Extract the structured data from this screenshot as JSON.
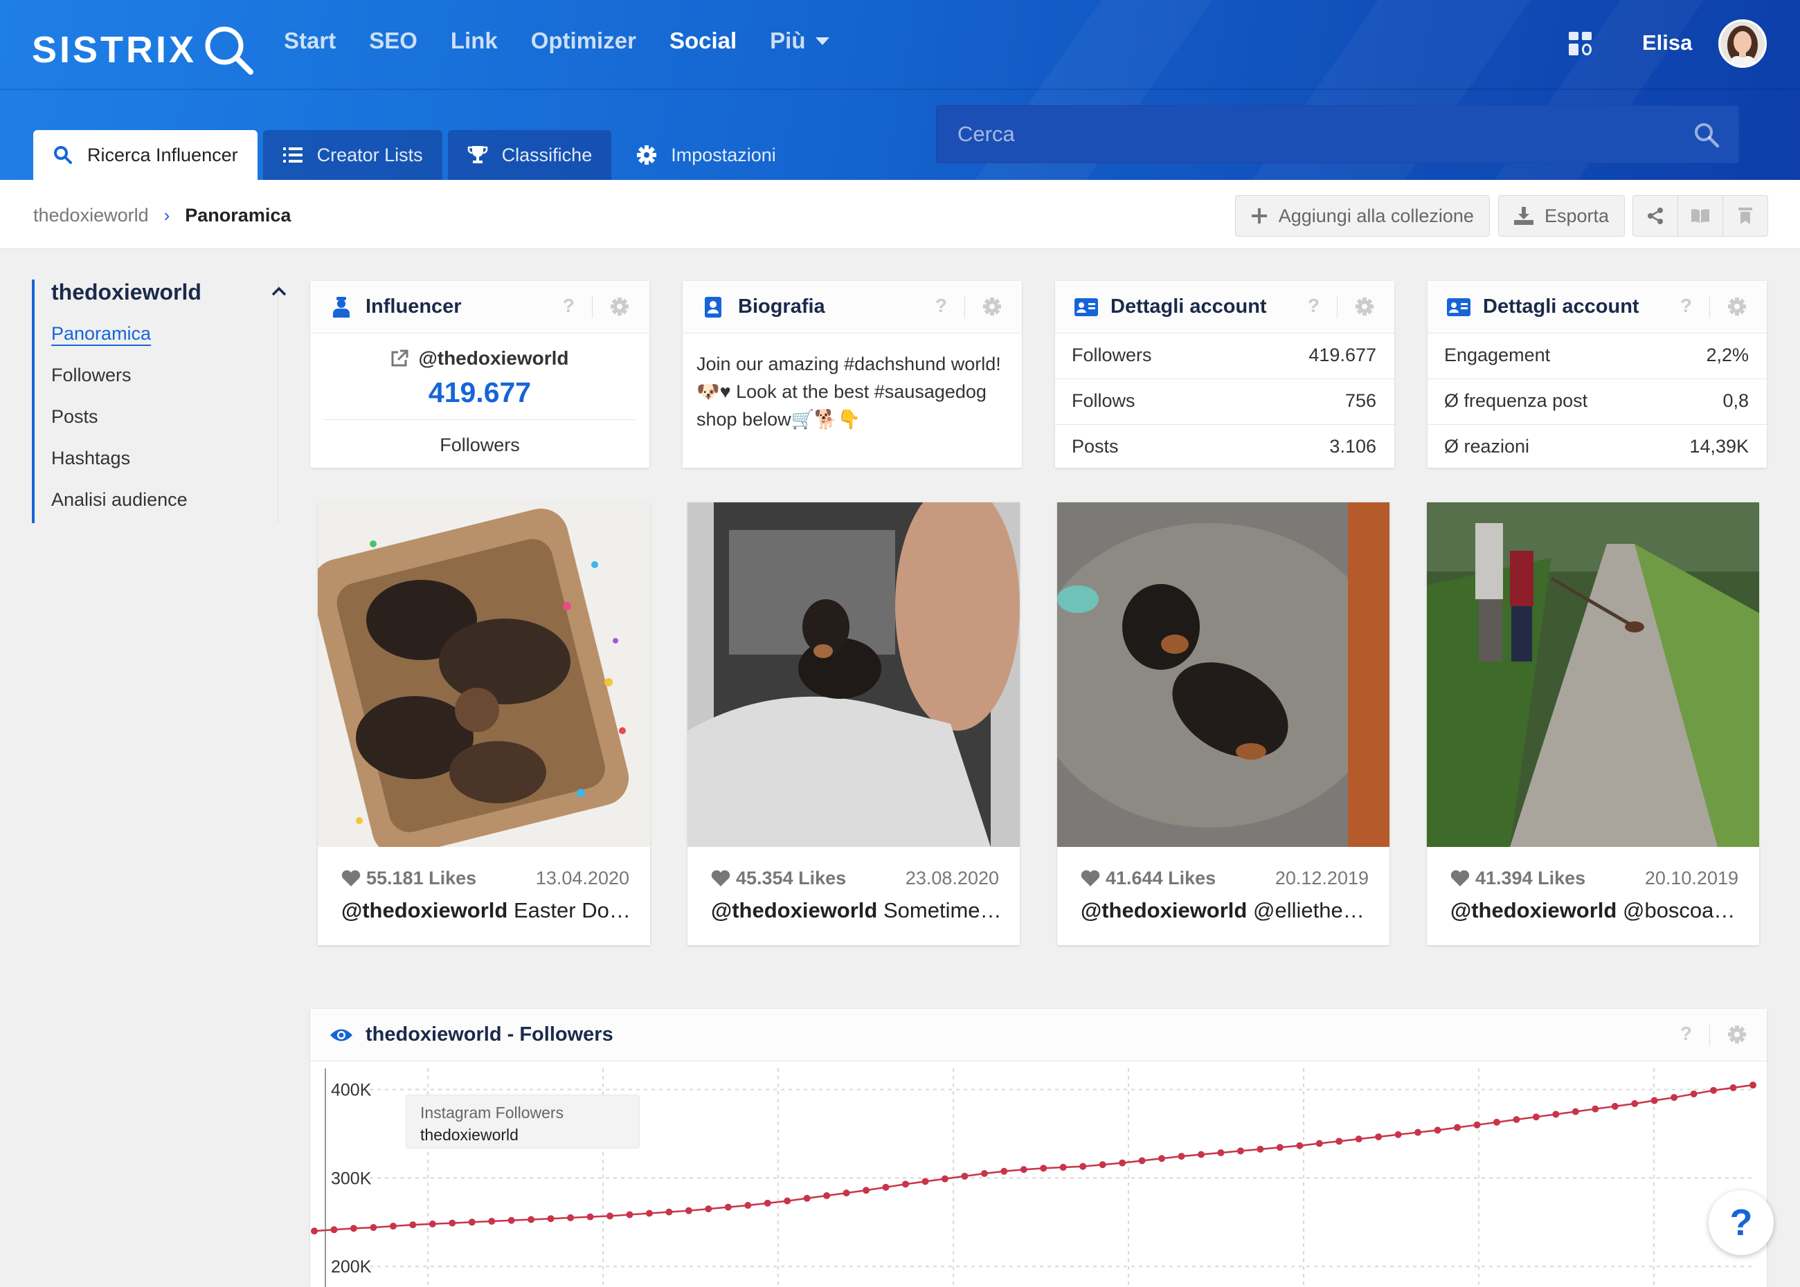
{
  "brand": {
    "logo_text": "SISTRIX"
  },
  "nav": {
    "items": [
      {
        "label": "Start"
      },
      {
        "label": "SEO"
      },
      {
        "label": "Link"
      },
      {
        "label": "Optimizer"
      },
      {
        "label": "Social",
        "active": true
      },
      {
        "label": "Più"
      }
    ]
  },
  "user": {
    "name": "Elisa"
  },
  "tabs": [
    {
      "label": "Ricerca Influencer",
      "icon": "search-icon",
      "active": true
    },
    {
      "label": "Creator Lists",
      "icon": "list-icon"
    },
    {
      "label": "Classifiche",
      "icon": "trophy-icon"
    },
    {
      "label": "Impostazioni",
      "icon": "gear-icon"
    }
  ],
  "search": {
    "placeholder": "Cerca",
    "value": ""
  },
  "breadcrumb": {
    "parent": "thedoxieworld",
    "separator": "›",
    "current": "Panoramica"
  },
  "actions": {
    "add_collection": "Aggiungi alla collezione",
    "export": "Esporta"
  },
  "sidebar": {
    "title": "thedoxieworld",
    "items": [
      {
        "label": "Panoramica",
        "active": true
      },
      {
        "label": "Followers"
      },
      {
        "label": "Posts"
      },
      {
        "label": "Hashtags"
      },
      {
        "label": "Analisi audience"
      }
    ]
  },
  "cards": {
    "influencer": {
      "title": "Influencer",
      "help": "?",
      "handle": "@thedoxieworld",
      "count": "419.677",
      "count_label": "Followers"
    },
    "bio": {
      "title": "Biografia",
      "help": "?",
      "text": "Join our amazing #dachshund world!🐶♥ Look at the best #sausagedog shop below🛒🐕👇"
    },
    "account1": {
      "title": "Dettagli account",
      "help": "?",
      "rows": [
        {
          "key": "Followers",
          "value": "419.677"
        },
        {
          "key": "Follows",
          "value": "756"
        },
        {
          "key": "Posts",
          "value": "3.106"
        }
      ]
    },
    "account2": {
      "title": "Dettagli account",
      "help": "?",
      "rows": [
        {
          "key": "Engagement",
          "value": "2,2%"
        },
        {
          "key": "Ø frequenza post",
          "value": "0,8"
        },
        {
          "key": "Ø reazioni",
          "value": "14,39K"
        }
      ]
    }
  },
  "posts": [
    {
      "likes": "55.181 Likes",
      "date": "13.04.2020",
      "user": "@thedoxieworld",
      "caption": "Easter Doxies"
    },
    {
      "likes": "45.354 Likes",
      "date": "23.08.2020",
      "user": "@thedoxieworld",
      "caption": "Sometimes..."
    },
    {
      "likes": "41.644 Likes",
      "date": "20.12.2019",
      "user": "@thedoxieworld",
      "caption": "@elliethemini"
    },
    {
      "likes": "41.394 Likes",
      "date": "20.10.2019",
      "user": "@thedoxieworld",
      "caption": "@boscoandfriends"
    }
  ],
  "chart": {
    "title": "thedoxieworld - Followers",
    "help": "?",
    "legend_line1": "Instagram Followers",
    "legend_line2": "thedoxieworld",
    "accent": "#c8344a"
  },
  "chart_data": {
    "type": "line",
    "title": "thedoxieworld - Followers",
    "xlabel": "",
    "ylabel": "",
    "y_ticks": [
      "400K",
      "300K",
      "200K"
    ],
    "y_tick_values": [
      400000,
      300000,
      200000
    ],
    "ylim": [
      190000,
      420000
    ],
    "grid": true,
    "legend": "top-left",
    "series": [
      {
        "name": "Instagram Followers",
        "values": [
          240000,
          241500,
          243000,
          244000,
          245500,
          247000,
          248000,
          249000,
          250000,
          251000,
          252000,
          253000,
          254000,
          255000,
          256000,
          257000,
          258500,
          260000,
          261500,
          263000,
          265000,
          267000,
          269000,
          271500,
          274000,
          277000,
          280000,
          283000,
          286000,
          289500,
          293000,
          296000,
          299000,
          302000,
          305000,
          307500,
          309500,
          311000,
          312000,
          313000,
          315000,
          317000,
          319500,
          322000,
          324500,
          326500,
          328500,
          330500,
          332500,
          334500,
          336500,
          339000,
          341500,
          344000,
          346500,
          349000,
          351500,
          354000,
          357000,
          360000,
          363000,
          366000,
          369000,
          372000,
          375000,
          378000,
          381000,
          384000,
          387500,
          391000,
          395000,
          399000,
          402000,
          405000
        ]
      }
    ]
  },
  "help_fab": {
    "label": "?"
  }
}
